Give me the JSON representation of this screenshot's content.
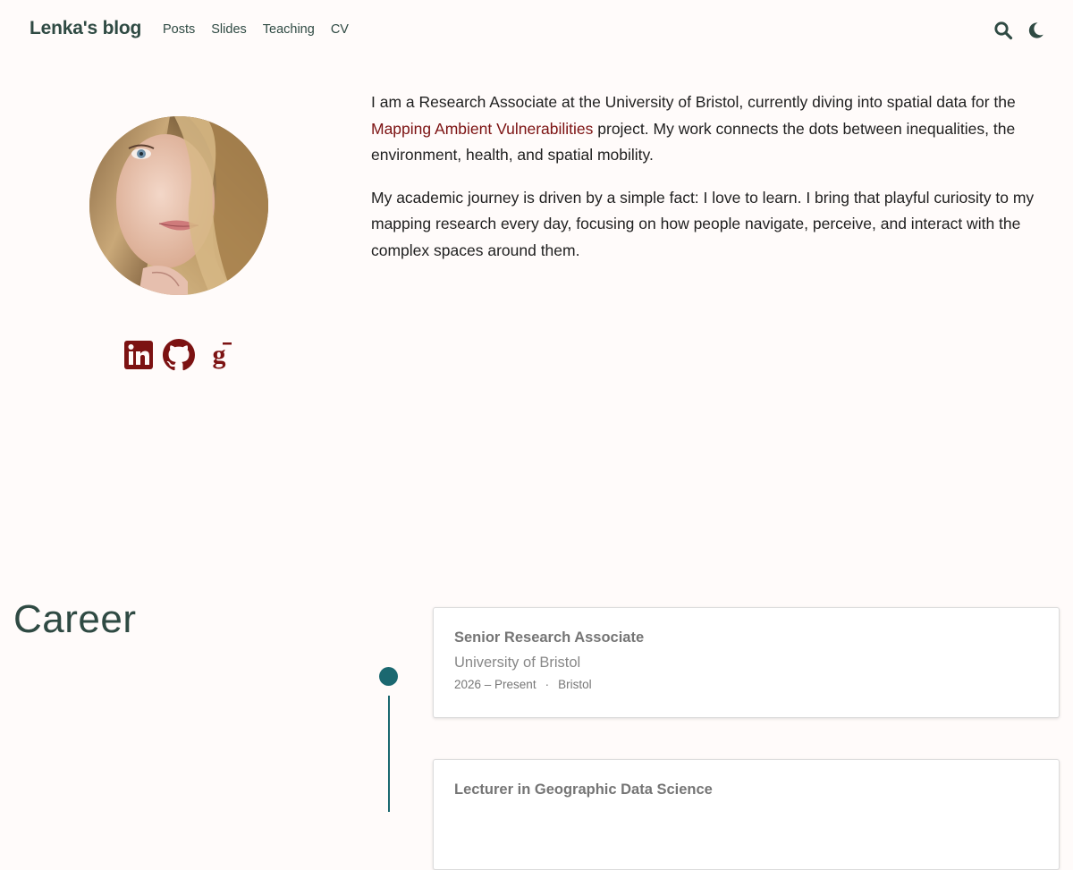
{
  "nav": {
    "brand": "Lenka's blog",
    "links": [
      "Posts",
      "Slides",
      "Teaching",
      "CV"
    ],
    "search_icon": "search-icon",
    "theme_icon": "moon-icon"
  },
  "profile": {
    "avatar_alt": "avatar",
    "social": [
      {
        "icon": "linkedin-icon"
      },
      {
        "icon": "github-icon"
      },
      {
        "icon": "google-scholar-icon"
      }
    ]
  },
  "bio": {
    "p1_before": "I am a Research Associate at the University of Bristol, currently diving into spatial data for the ",
    "p1_link": "Mapping Ambient Vulnerabilities",
    "p1_after": " project. My work connects the dots between inequalities, the environment, health, and spatial mobility.",
    "p2": "My academic journey is driven by a simple fact: I love to learn. I bring that playful curiosity to my mapping research every day, focusing on how people navigate, perceive, and interact with the complex spaces around them."
  },
  "career": {
    "title": "Career",
    "items": [
      {
        "title": "Senior Research Associate",
        "org": "University of Bristol",
        "dates": "2026 – Present",
        "separator": "·",
        "location": "Bristol"
      },
      {
        "title": "Lecturer in Geographic Data Science",
        "org": "",
        "dates": "",
        "separator": "",
        "location": ""
      }
    ]
  },
  "colors": {
    "background": "#fffbfa",
    "brand": "#2f4a43",
    "link": "#7c1212",
    "timeline": "#1b6870"
  }
}
